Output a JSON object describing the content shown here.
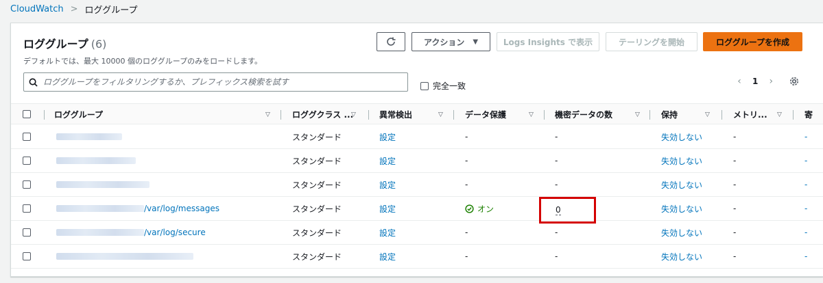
{
  "breadcrumb": {
    "root": "CloudWatch",
    "separator": ">",
    "current": "ロググループ"
  },
  "header": {
    "title": "ロググループ",
    "count": "(6)",
    "description": "デフォルトでは、最大 10000 個のロググループのみをロードします。",
    "actions_label": "アクション",
    "insights_label": "Logs Insights で表示",
    "tail_label": "テーリングを開始",
    "create_label": "ロググループを作成"
  },
  "search": {
    "placeholder": "ロググループをフィルタリングするか、プレフィックス検索を試す"
  },
  "exact_match_label": "完全一致",
  "pagination": {
    "current_page": "1"
  },
  "table": {
    "columns": [
      "ロググループ",
      "ロググクラス ...",
      "異常検出",
      "データ保護",
      "機密データの数",
      "保持",
      "メトリ...",
      "寄"
    ],
    "rows": [
      {
        "name_suffix": "",
        "class": "スタンダード",
        "anomaly": "設定",
        "protection": "-",
        "sensitive": "-",
        "retention": "失効しない",
        "metric": "-",
        "contrib": "-"
      },
      {
        "name_suffix": "",
        "class": "スタンダード",
        "anomaly": "設定",
        "protection": "-",
        "sensitive": "-",
        "retention": "失効しない",
        "metric": "-",
        "contrib": "-"
      },
      {
        "name_suffix": "",
        "class": "スタンダード",
        "anomaly": "設定",
        "protection": "-",
        "sensitive": "-",
        "retention": "失効しない",
        "metric": "-",
        "contrib": "-"
      },
      {
        "name_suffix": "/var/log/messages",
        "class": "スタンダード",
        "anomaly": "設定",
        "protection": "オン",
        "sensitive": "0",
        "retention": "失効しない",
        "metric": "-",
        "contrib": "-"
      },
      {
        "name_suffix": "/var/log/secure",
        "class": "スタンダード",
        "anomaly": "設定",
        "protection": "-",
        "sensitive": "-",
        "retention": "失効しない",
        "metric": "-",
        "contrib": "-"
      },
      {
        "name_suffix": "",
        "class": "スタンダード",
        "anomaly": "設定",
        "protection": "-",
        "sensitive": "-",
        "retention": "失効しない",
        "metric": "-",
        "contrib": "-"
      }
    ]
  },
  "colors": {
    "link": "#0073bb",
    "primary": "#ec7211",
    "success": "#1d8102",
    "highlight": "#d40000"
  }
}
